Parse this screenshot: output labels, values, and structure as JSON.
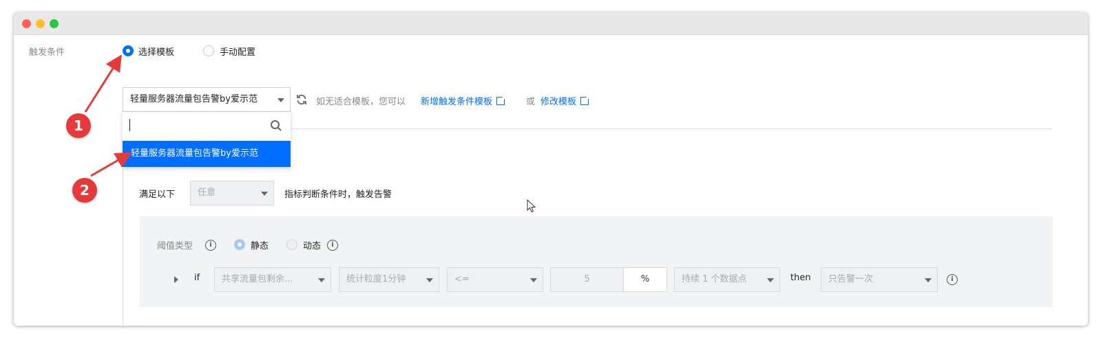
{
  "form": {
    "trigger_label": "触发条件",
    "radio_template": "选择模板",
    "radio_manual": "手动配置",
    "template_select_value": "轻量服务器流量包告警by爱示范",
    "hint_text": "如无适合模板，您可以",
    "link_new": "新增触发条件模板",
    "or_text": "或",
    "link_edit": "修改模板"
  },
  "dropdown": {
    "search_placeholder": "",
    "option_selected": "轻量服务器流量包告警by爱示范"
  },
  "condition": {
    "satisfy_label": "满足以下",
    "satisfy_select": "任意",
    "satisfy_suffix": "指标判断条件时，触发告警"
  },
  "threshold": {
    "type_label": "阈值类型",
    "static_label": "静态",
    "dynamic_label": "动态",
    "if_label": "if",
    "metric": "共享流量包剩余...",
    "granularity": "统计粒度1分钟",
    "operator": "<=",
    "value": "5",
    "unit": "%",
    "duration": "持续 1 个数据点",
    "then_label": "then",
    "alert_mode": "只告警一次"
  },
  "annotations": {
    "step1": "1",
    "step2": "2"
  },
  "colors": {
    "accent": "#006eff",
    "annotation_red": "#e63a3a"
  }
}
